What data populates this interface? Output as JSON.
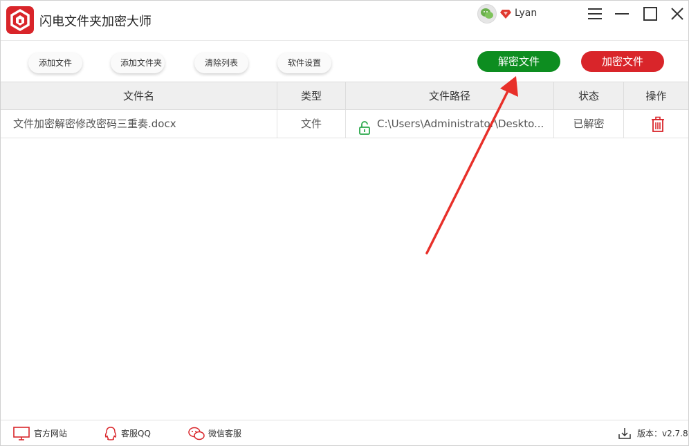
{
  "app": {
    "title": "闪电文件夹加密大师",
    "username": "Lyan"
  },
  "toolbar": {
    "add_file": "添加文件",
    "add_folder": "添加文件夹",
    "clear_list": "清除列表",
    "settings": "软件设置",
    "decrypt": "解密文件",
    "encrypt": "加密文件"
  },
  "table": {
    "headers": [
      "文件名",
      "类型",
      "文件路径",
      "状态",
      "操作"
    ],
    "rows": [
      {
        "name": "文件加密解密修改密码三重奏.docx",
        "type": "文件",
        "path": "C:\\Users\\Administrator\\Deskto...",
        "status": "已解密"
      }
    ]
  },
  "footer": {
    "website": "官方网站",
    "qq": "客服QQ",
    "wechat": "微信客服",
    "version": "版本：v2.7.8"
  },
  "colors": {
    "brand_red": "#d9252a",
    "decrypt_green": "#0d8d20"
  }
}
